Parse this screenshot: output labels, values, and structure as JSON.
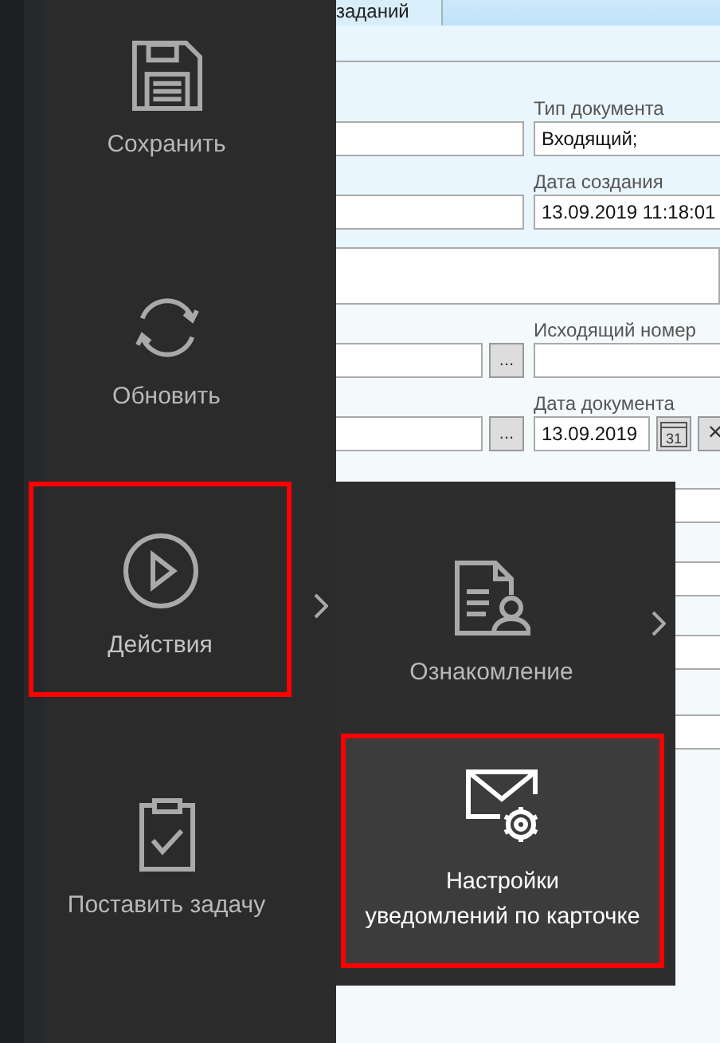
{
  "tab": {
    "label": "заданий"
  },
  "form": {
    "rows": [
      {
        "left": {
          "kind": "plain"
        },
        "right": {
          "kind": "text",
          "label": "Тип документа",
          "value": "Входящий;"
        }
      },
      {
        "left": {
          "kind": "plain"
        },
        "right": {
          "kind": "text",
          "label": "Дата создания",
          "value": "13.09.2019  11:18:01"
        }
      },
      {
        "left": {
          "kind": "memo"
        }
      },
      {
        "left": {
          "kind": "lookup",
          "button": "..."
        },
        "right": {
          "kind": "text",
          "label": "Исходящий номер"
        }
      },
      {
        "left": {
          "kind": "lookup",
          "button": "..."
        },
        "right": {
          "kind": "date",
          "label": "Дата документа",
          "value": "13.09.2019",
          "calendar_day": "31",
          "clear": "×"
        }
      }
    ]
  },
  "menu": {
    "items": [
      {
        "kind": "save",
        "label": "Сохранить",
        "highlighted": false,
        "has_submenu": false
      },
      {
        "kind": "refresh",
        "label": "Обновить",
        "highlighted": false,
        "has_submenu": false
      },
      {
        "kind": "actions",
        "label": "Действия",
        "highlighted": true,
        "has_submenu": true
      },
      {
        "kind": "task",
        "label": "Поставить задачу",
        "highlighted": false,
        "has_submenu": false
      }
    ],
    "submenu": [
      {
        "kind": "review",
        "label_lines": [
          "Ознакомление"
        ],
        "highlighted": false,
        "selected": false,
        "has_submenu": true
      },
      {
        "kind": "notify",
        "label_lines": [
          "Настройки",
          "уведомлений по карточке"
        ],
        "highlighted": true,
        "selected": true,
        "has_submenu": false
      }
    ]
  }
}
